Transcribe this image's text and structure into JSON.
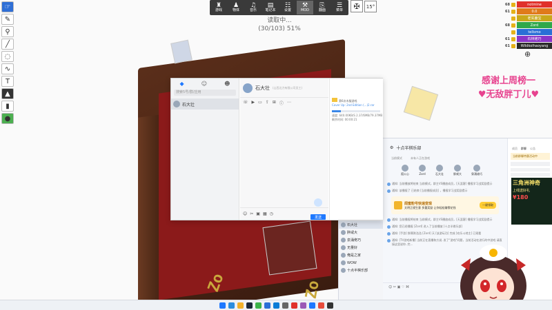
{
  "left_toolbar": [
    "pointer",
    "pen",
    "pin",
    "line",
    "lasso",
    "rope",
    "text",
    "stamp",
    "eraser",
    "settings"
  ],
  "top_toolbar": {
    "buttons": [
      {
        "label": "游戏",
        "icon": "chess-rook-icon"
      },
      {
        "label": "物体",
        "icon": "chess-pawn-icon"
      },
      {
        "label": "音乐",
        "icon": "speaker-icon"
      },
      {
        "label": "笔记本",
        "icon": "notebook-icon"
      },
      {
        "label": "设置",
        "icon": "sliders-icon"
      },
      {
        "label": "MOD",
        "icon": "tools-icon"
      },
      {
        "label": "翻面",
        "icon": "flip-icon"
      },
      {
        "label": "菜单",
        "icon": "menu-icon"
      }
    ],
    "rotation": "15°"
  },
  "loading": {
    "line1": "读取中...",
    "line2": "(30/103) 51%"
  },
  "players": [
    {
      "num": "68",
      "name": "notmine",
      "color": "#e0312b"
    },
    {
      "num": "61",
      "name": "0.0",
      "color": "#e07a1b"
    },
    {
      "num": "",
      "name": "老实鹿宝",
      "color": "#c9a81a"
    },
    {
      "num": "68",
      "name": "Zord",
      "color": "#2fa84a"
    },
    {
      "num": "",
      "name": "tellsmo",
      "color": "#2a6fd6"
    },
    {
      "num": "61",
      "name": "石林佬巧",
      "color": "#8b36c9"
    },
    {
      "num": "61",
      "name": "Wildkolhaoyang",
      "color": "#2a2a2a"
    }
  ],
  "thanks": {
    "line1": "感谢上周榜一",
    "line2": "♥无敌胖丁儿♥"
  },
  "chat_client": {
    "search_placeholder": "搜索5号/群/应用",
    "contact": "石大壮",
    "header_name": "石大壮",
    "header_sub": "(山西达力有限公司员工)",
    "file_name": "第6次木服游戏",
    "file_sub": "Cover Up: 2nd Edition (...)2.rar",
    "file_speed": "速度: 640.00KB/S",
    "file_size": "2.37/6MB/79.37MB",
    "file_time": "剩余时间: 00:00:21",
    "file_progress": 0.18,
    "send": "发送"
  },
  "group_chat": {
    "title": "十点半棋乐部",
    "tabs": [
      "当前模式",
      "未有人正在游戏"
    ],
    "members": [
      {
        "name": "孤火心"
      },
      {
        "name": "Zord"
      },
      {
        "name": "石大壮"
      },
      {
        "name": "胖咸大"
      },
      {
        "name": "泉涌佬巧"
      }
    ],
    "messages": [
      "通知: 当前播放将结束 当前模式，群主VS播放成员，[天涯客] 播报学习战奖励提示",
      "通知: 该播报了 已结束 [当前播报成员] ，播报学习战奖励提示",
      "通知: 当前播报将结束 当前模式，群主VS播放成员，[天涯客] 播报学习战奖励提示",
      "通知: 您已经播报 [Zord] 进入了当前播放 [十点半棋乐部]",
      "通知: [手游] 鲜蕉陈浩浩 [Zord] 天 [该游玩功] 完成 [欢乐斗地主] 已观看",
      "通知: [TV游戏新播] 当前正在直播和方说..发了\"游戏\"问题，当前活动在进行的中游戏 请直接这里说你..完..."
    ],
    "gift": {
      "title": "闺蜜粉号快速变现",
      "sub": "文明正规生意 多重奖励 让你轻松赚零花钱",
      "button": "一键领取"
    },
    "list": [
      {
        "name": "石大壮"
      },
      {
        "name": "胖咸大"
      },
      {
        "name": "泉涌佬巧"
      },
      {
        "name": "无量好"
      },
      {
        "name": "俺是之家"
      },
      {
        "name": "WOW"
      },
      {
        "name": "十点半棋乐部"
      }
    ],
    "side_tabs": [
      "成员",
      "群聊",
      "公告"
    ],
    "side_promo": "当前群聊特惠活动中"
  },
  "ad": {
    "title": "三角洲神奇",
    "sub": "上线送好礼",
    "price": "¥180"
  },
  "taskbar_icons": [
    "windows-icon",
    "edge-icon",
    "explorer-icon",
    "steam-icon",
    "chat-icon",
    "store-icon",
    "mail-icon",
    "settings-icon",
    "game-icon",
    "media-icon",
    "app-icon",
    "app2-icon",
    "app3-icon"
  ]
}
